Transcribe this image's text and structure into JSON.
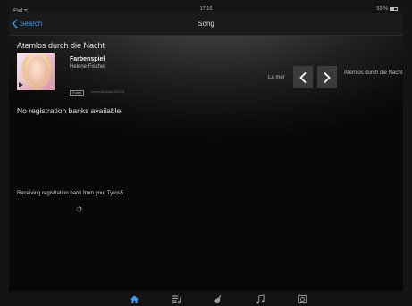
{
  "status_bar": {
    "carrier": "iPad ᯤ",
    "time": "17:16",
    "battery": "53 %"
  },
  "nav": {
    "back_label": "Search",
    "title": "Song"
  },
  "song": {
    "title": "Atemlos durch die Nacht",
    "album": "Farbenspiel",
    "artist": "Helene Fischer",
    "badge": "iTunes",
    "copyright": "Universal Music 2013 ℗"
  },
  "neighbors": {
    "previous": "La mer",
    "next": "Atemlos durch die Nacht"
  },
  "messages": {
    "no_banks": "No registration banks available",
    "receiving": "Receiving registration bank from your Tyros5"
  },
  "tabs": [
    {
      "icon": "home-icon",
      "active": true
    },
    {
      "icon": "songlist-icon",
      "active": false
    },
    {
      "icon": "guitar-icon",
      "active": false
    },
    {
      "icon": "music-note-icon",
      "active": false
    },
    {
      "icon": "settings-icon",
      "active": false
    }
  ],
  "colors": {
    "accent": "#3a9bf0",
    "background": "#0e0e0e",
    "tab_inactive": "#9a9a9a"
  }
}
